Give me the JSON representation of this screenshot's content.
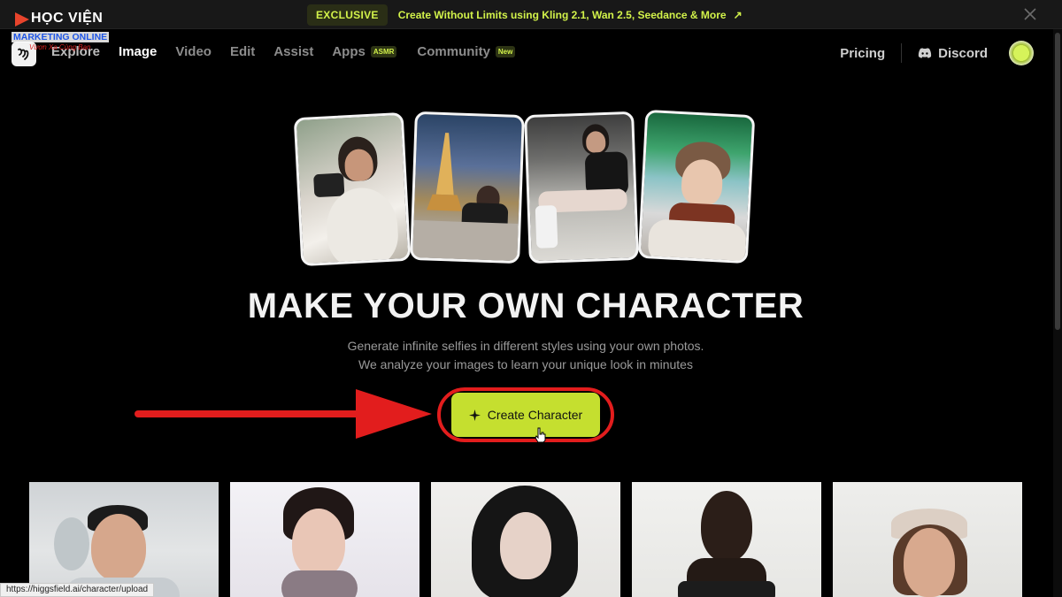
{
  "banner": {
    "badge": "EXCLUSIVE",
    "text": "Create Without Limits using Kling 2.1, Wan 2.5, Seedance & More",
    "arrow": "↗",
    "close_icon": "close-icon"
  },
  "watermark": {
    "title": "HỌC VIỆN",
    "subtitle": "MARKETING ONLINE",
    "tagline": "Vươn Xa Cùng Bạn"
  },
  "nav": {
    "items": [
      {
        "label": "Explore"
      },
      {
        "label": "Image"
      },
      {
        "label": "Video"
      },
      {
        "label": "Edit"
      },
      {
        "label": "Assist"
      },
      {
        "label": "Apps",
        "tag": "ASMR"
      },
      {
        "label": "Community",
        "tag": "New"
      }
    ],
    "active": "Image",
    "pricing": "Pricing",
    "discord": "Discord"
  },
  "hero": {
    "title": "MAKE YOUR OWN CHARACTER",
    "subtitle_line1": "Generate infinite selfies in different styles using your own photos.",
    "subtitle_line2": "We analyze your images to learn your unique look in minutes",
    "cta_label": "Create Character",
    "cta_icon": "sparkle-icon"
  },
  "status": {
    "url": "https://higgsfield.ai/character/upload"
  },
  "colors": {
    "accent": "#c5df2f",
    "annotation": "#e21d1d",
    "background": "#000000"
  }
}
